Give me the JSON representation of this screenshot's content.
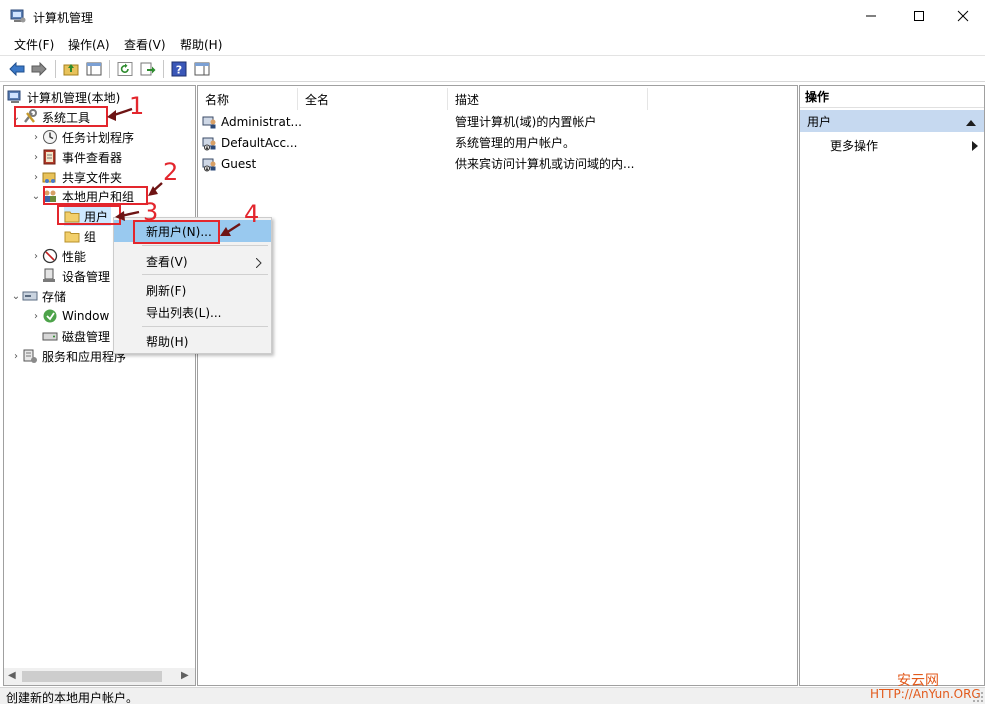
{
  "window": {
    "title": "计算机管理"
  },
  "menu": [
    "文件(F)",
    "操作(A)",
    "查看(V)",
    "帮助(H)"
  ],
  "tree": {
    "root": "计算机管理(本地)",
    "system_tools": "系统工具",
    "task_scheduler": "任务计划程序",
    "event_viewer": "事件查看器",
    "shared_folders": "共享文件夹",
    "local_users_groups": "本地用户和组",
    "users": "用户",
    "groups": "组",
    "performance": "性能",
    "device_manager": "设备管理",
    "storage": "存储",
    "windows_backup": "Window",
    "disk_management": "磁盘管理",
    "services_apps": "服务和应用程序"
  },
  "list": {
    "columns": [
      "名称",
      "全名",
      "描述"
    ],
    "rows": [
      {
        "name": "Administrat...",
        "fullname": "",
        "desc": "管理计算机(域)的内置帐户"
      },
      {
        "name": "DefaultAcc...",
        "fullname": "",
        "desc": "系统管理的用户帐户。"
      },
      {
        "name": "Guest",
        "fullname": "",
        "desc": "供来宾访问计算机或访问域的内..."
      }
    ]
  },
  "actions": {
    "header": "操作",
    "section": "用户",
    "more": "更多操作"
  },
  "context_menu": {
    "new_user": "新用户(N)...",
    "view": "查看(V)",
    "refresh": "刷新(F)",
    "export": "导出列表(L)...",
    "help": "帮助(H)"
  },
  "annotations": [
    "1",
    "2",
    "3",
    "4"
  ],
  "status": "创建新的本地用户帐户。",
  "watermark": {
    "cn": "安云网",
    "url": "HTTP://AnYun.ORG"
  },
  "colors": {
    "accent_red": "#e3262d",
    "selection_blue": "#99c9ef",
    "watermark": "#e25a1c"
  }
}
